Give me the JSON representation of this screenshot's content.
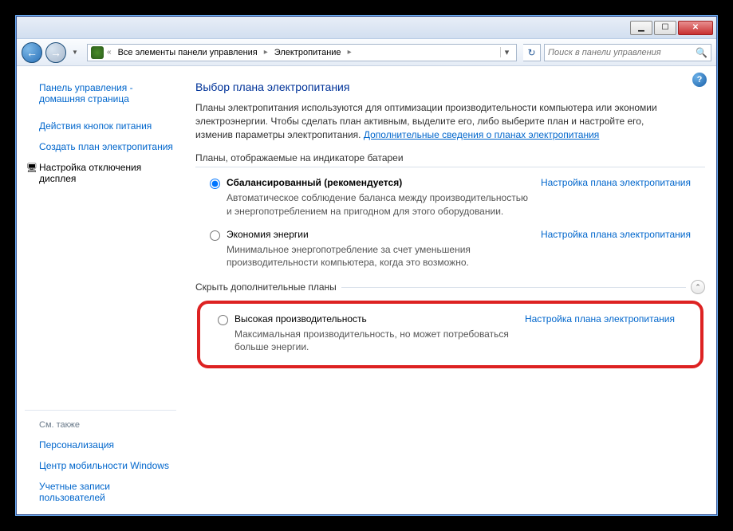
{
  "breadcrumb": {
    "items": [
      "Все элементы панели управления",
      "Электропитание"
    ]
  },
  "search": {
    "placeholder": "Поиск в панели управления"
  },
  "sidebar": {
    "home": "Панель управления - домашняя страница",
    "links": [
      "Действия кнопок питания",
      "Создать план электропитания",
      "Настройка отключения дисплея"
    ],
    "see_also_heading": "См. также",
    "see_also": [
      "Персонализация",
      "Центр мобильности Windows",
      "Учетные записи пользователей"
    ]
  },
  "content": {
    "title": "Выбор плана электропитания",
    "description": "Планы электропитания используются для оптимизации производительности компьютера или экономии электроэнергии. Чтобы сделать план активным, выделите его, либо выберите план и настройте его, изменив параметры электропитания. ",
    "more_link": "Дополнительные сведения о планах электропитания",
    "group1_label": "Планы, отображаемые на индикаторе батареи",
    "plans": [
      {
        "name": "Сбалансированный (рекомендуется)",
        "desc": "Автоматическое соблюдение баланса между производительностью и энергопотреблением на пригодном для этого оборудовании.",
        "link": "Настройка плана электропитания"
      },
      {
        "name": "Экономия энергии",
        "desc": "Минимальное энергопотребление за счет уменьшения производительности компьютера, когда это возможно.",
        "link": "Настройка плана электропитания"
      }
    ],
    "hide_label": "Скрыть дополнительные планы",
    "extra_plan": {
      "name": "Высокая производительность",
      "desc": "Максимальная производительность, но может потребоваться больше энергии.",
      "link": "Настройка плана электропитания"
    }
  }
}
